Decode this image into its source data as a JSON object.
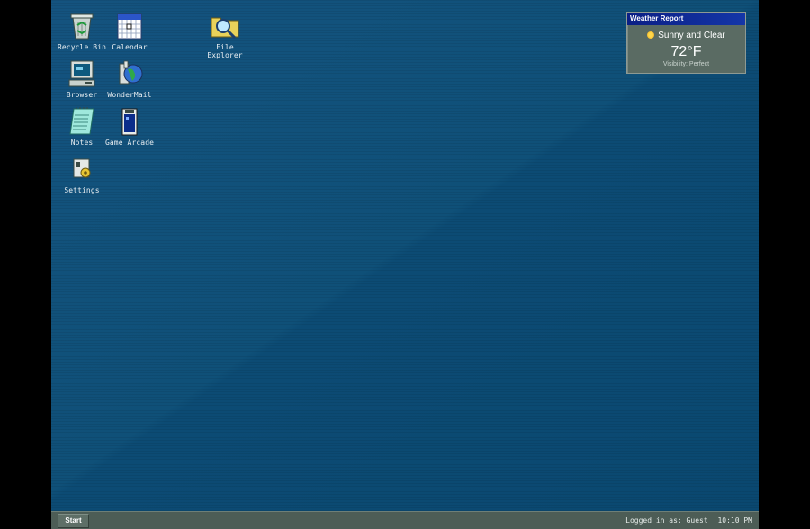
{
  "desktop": {
    "icons": [
      {
        "label": "Recycle Bin",
        "icon": "recycle-bin-icon"
      },
      {
        "label": "Calendar",
        "icon": "calendar-icon"
      },
      {
        "label": "File Explorer",
        "icon": "file-explorer-icon"
      },
      {
        "label": "Browser",
        "icon": "browser-icon"
      },
      {
        "label": "WonderMail",
        "icon": "wondermail-icon"
      },
      {
        "label": "Notes",
        "icon": "notes-icon"
      },
      {
        "label": "Game Arcade",
        "icon": "game-arcade-icon"
      },
      {
        "label": "Settings",
        "icon": "settings-icon"
      }
    ]
  },
  "weather": {
    "title": "Weather Report",
    "condition": "Sunny and Clear",
    "temperature": "72°F",
    "visibility": "Visibility: Perfect",
    "icon": "sun-icon"
  },
  "taskbar": {
    "start_label": "Start",
    "user_status": "Logged in as: Guest",
    "time": "10:10 PM"
  },
  "colors": {
    "desktop": "#0f5078",
    "taskbar": "#4d5d56",
    "weather_title": "#0b1f85"
  }
}
